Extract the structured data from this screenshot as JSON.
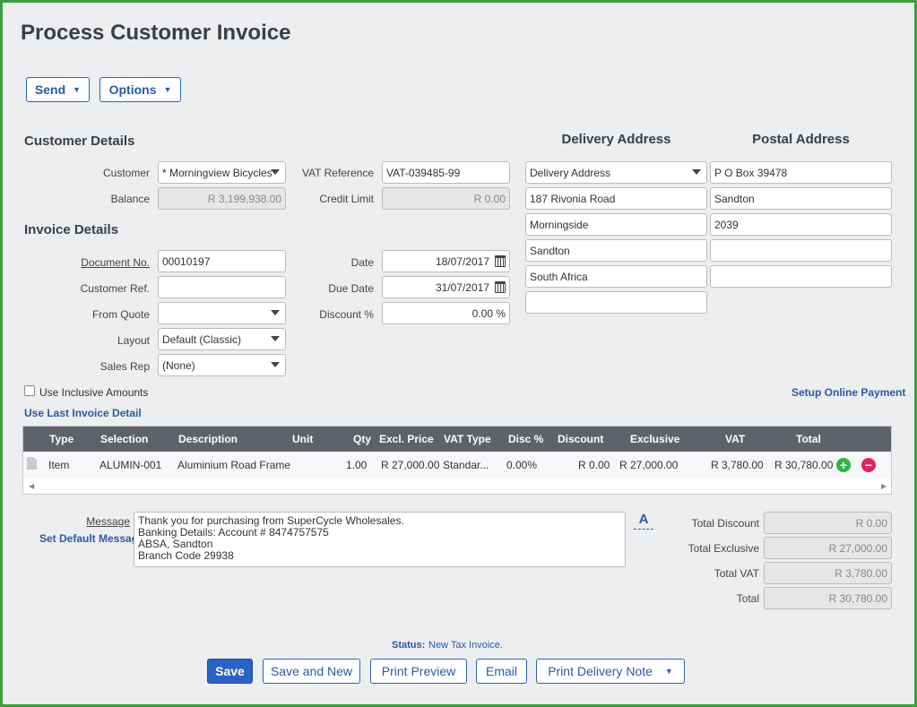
{
  "page": {
    "title": "Process Customer Invoice"
  },
  "toolbar": {
    "send_label": "Send",
    "options_label": "Options"
  },
  "customer_details": {
    "heading": "Customer Details",
    "customer_label": "Customer",
    "customer_value": "* Morningview Bicycles",
    "balance_label": "Balance",
    "balance_value": "R 3,199,938.00",
    "vat_ref_label": "VAT Reference",
    "vat_ref_value": "VAT-039485-99",
    "credit_limit_label": "Credit Limit",
    "credit_limit_value": "R 0.00"
  },
  "invoice_details": {
    "heading": "Invoice Details",
    "doc_no_label": "Document No.",
    "doc_no_value": "00010197",
    "customer_ref_label": "Customer Ref.",
    "customer_ref_value": "",
    "from_quote_label": "From Quote",
    "from_quote_value": "",
    "layout_label": "Layout",
    "layout_value": "Default (Classic)",
    "sales_rep_label": "Sales Rep",
    "sales_rep_value": "(None)",
    "date_label": "Date",
    "date_value": "18/07/2017",
    "due_date_label": "Due Date",
    "due_date_value": "31/07/2017",
    "discount_label": "Discount %",
    "discount_value": "0.00 %"
  },
  "delivery_address": {
    "heading": "Delivery Address",
    "select_value": "Delivery Address",
    "lines": [
      "187 Rivonia Road",
      "Morningside",
      "Sandton",
      "South Africa",
      ""
    ]
  },
  "postal_address": {
    "heading": "Postal Address",
    "lines": [
      "P O Box 39478",
      "Sandton",
      "2039",
      "",
      ""
    ]
  },
  "options": {
    "inclusive_label": "Use Inclusive Amounts",
    "setup_payment_link": "Setup Online Payment",
    "last_invoice_link": "Use Last Invoice Detail"
  },
  "grid": {
    "headers": [
      "Type",
      "Selection",
      "Description",
      "Unit",
      "Qty",
      "Excl. Price",
      "VAT Type",
      "Disc %",
      "Discount",
      "Exclusive",
      "VAT",
      "Total"
    ],
    "rows": [
      {
        "type": "Item",
        "selection": "ALUMIN-001",
        "description": "Aluminium Road Frame",
        "unit": "",
        "qty": "1.00",
        "excl_price": "R 27,000.00",
        "vat_type": "Standar...",
        "disc_pct": "0.00%",
        "discount": "R 0.00",
        "exclusive": "R 27,000.00",
        "vat": "R 3,780.00",
        "total": "R 30,780.00"
      }
    ],
    "add_icon": "plus-circle-icon",
    "remove_icon": "minus-circle-icon"
  },
  "message": {
    "label": "Message",
    "set_default_link": "Set Default Message",
    "lines": [
      "Thank you for purchasing from SuperCycle Wholesales.",
      "Banking Details:  Account # 8474757575",
      "ABSA, Sandton",
      "Branch Code 29938"
    ],
    "font_button": "A"
  },
  "totals": {
    "discount_label": "Total Discount",
    "discount_value": "R 0.00",
    "exclusive_label": "Total Exclusive",
    "exclusive_value": "R 27,000.00",
    "vat_label": "Total VAT",
    "vat_value": "R 3,780.00",
    "total_label": "Total",
    "total_value": "R 30,780.00"
  },
  "status": {
    "label": "Status:",
    "value": "New Tax Invoice."
  },
  "actions": {
    "save": "Save",
    "save_new": "Save and New",
    "print_preview": "Print Preview",
    "email": "Email",
    "print_delivery": "Print Delivery Note"
  },
  "colors": {
    "frame_border": "#3f9c3f",
    "primary": "#2a63c4",
    "link": "#2b5aa6",
    "grid_header": "#5f6369",
    "add": "#2fb344",
    "remove": "#e0245e"
  }
}
